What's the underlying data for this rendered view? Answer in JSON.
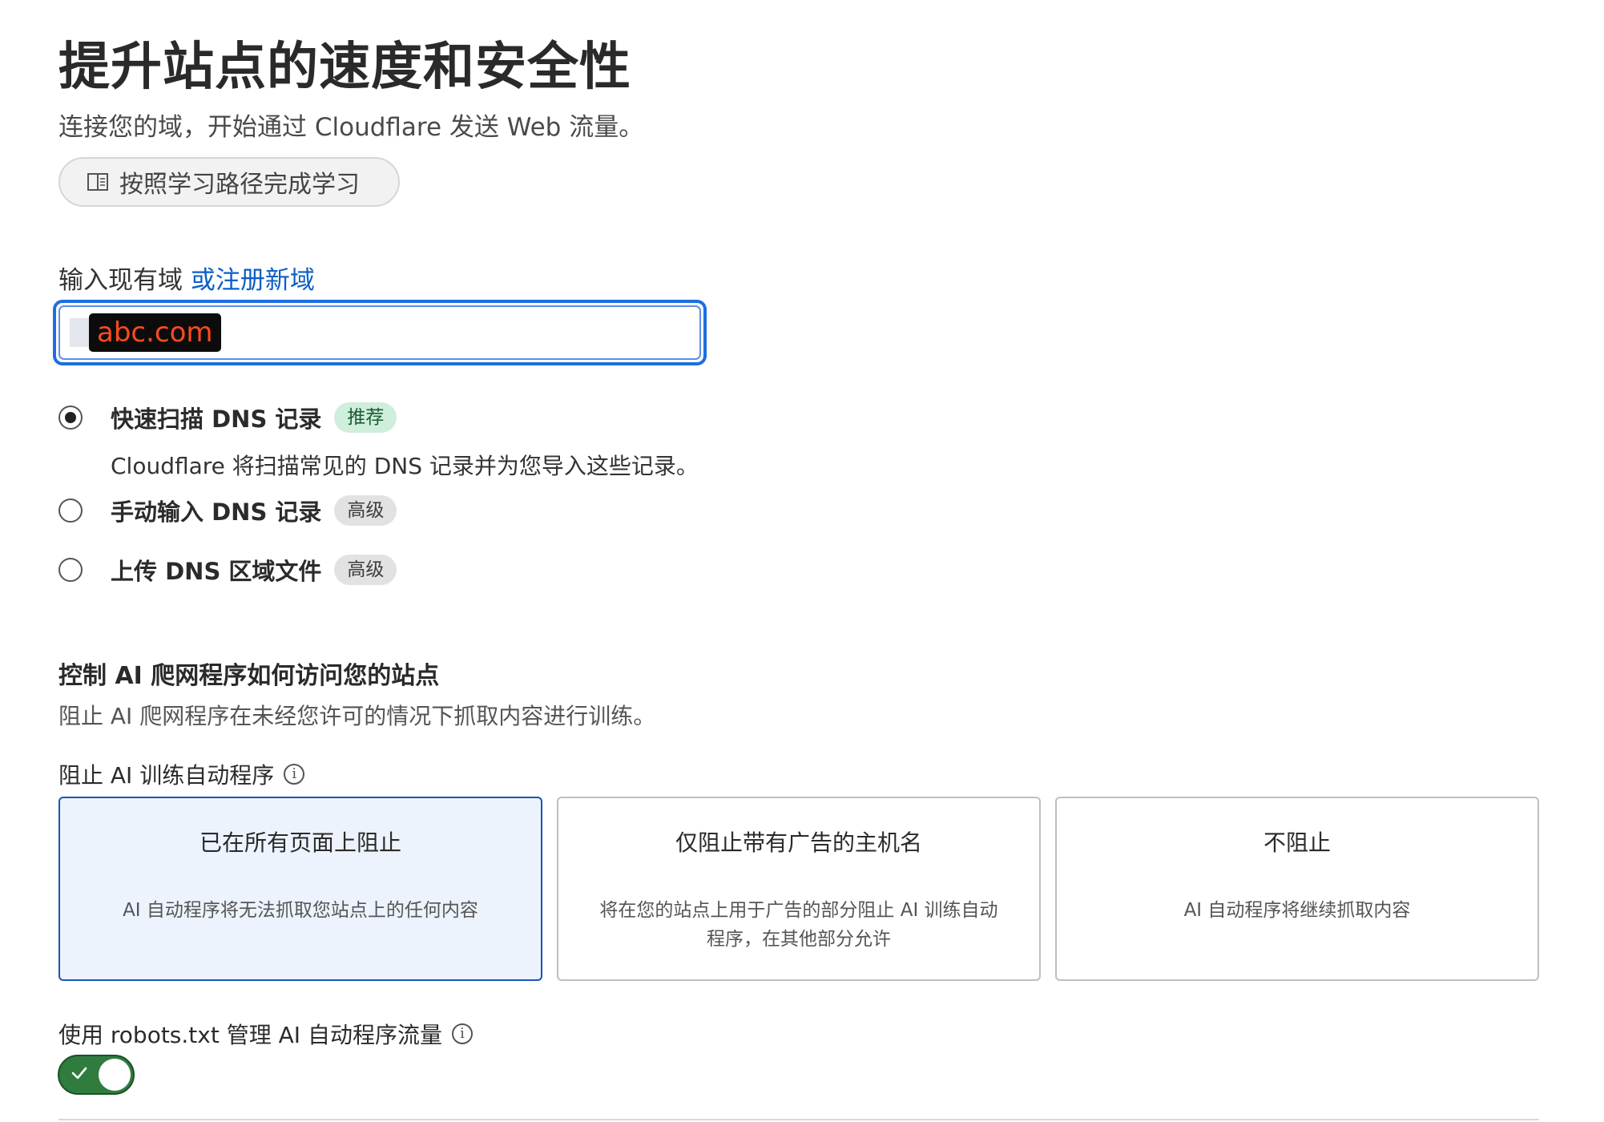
{
  "header": {
    "title": "提升站点的速度和安全性",
    "subtitle": "连接您的域，开始通过 Cloudflare 发送 Web 流量。",
    "learn_button_label": "按照学习路径完成学习",
    "learn_button_icon": "book-open-icon"
  },
  "domain": {
    "label": "输入现有域",
    "register_link": "或注册新域",
    "input_value": "abc.com"
  },
  "dns_options": [
    {
      "label": "快速扫描 DNS 记录",
      "badge": "推荐",
      "checked": true,
      "description": "Cloudflare 将扫描常见的 DNS 记录并为您导入这些记录。"
    },
    {
      "label": "手动输入 DNS 记录",
      "badge": "高级",
      "checked": false
    },
    {
      "label": "上传 DNS 区域文件",
      "badge": "高级",
      "checked": false
    }
  ],
  "ai": {
    "title": "控制 AI 爬网程序如何访问您的站点",
    "description": "阻止 AI 爬网程序在未经您许可的情况下抓取内容进行训练。",
    "block_label": "阻止 AI 训练自动程序",
    "info_icon": "info-icon",
    "options": [
      {
        "title": "已在所有页面上阻止",
        "description": "AI 自动程序将无法抓取您站点上的任何内容",
        "selected": true
      },
      {
        "title": "仅阻止带有广告的主机名",
        "description": "将在您的站点上用于广告的部分阻止 AI 训练自动程序，在其他部分允许",
        "selected": false
      },
      {
        "title": "不阻止",
        "description": "AI 自动程序将继续抓取内容",
        "selected": false
      }
    ],
    "robots_label": "使用 robots.txt 管理 AI 自动程序流量",
    "robots_toggle_on": true
  },
  "colors": {
    "link": "#0a5fc8",
    "focus_border": "#1d6fe0",
    "selected_card_bg": "#edf3fd",
    "selected_card_border": "#1a55b8",
    "toggle_on": "#2f7c3e",
    "badge_green_bg": "#cfeedb",
    "badge_gray_bg": "#e2e2e2"
  }
}
